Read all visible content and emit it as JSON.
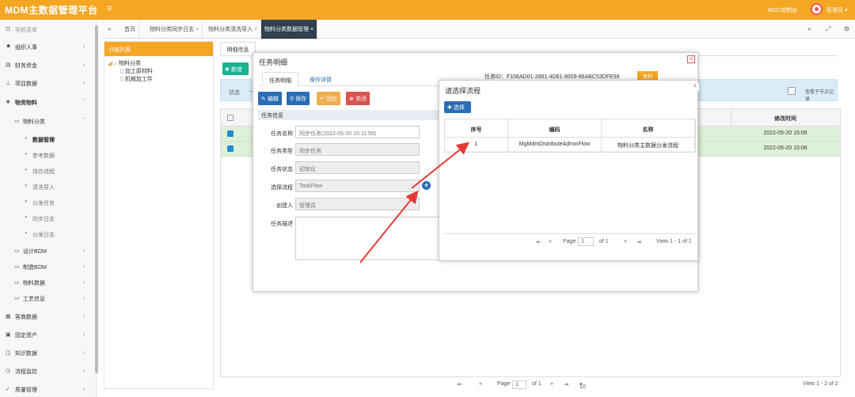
{
  "app": {
    "title": "MDM主数据管理平台",
    "menu_icon": "≡",
    "top_link": "MDC控制台",
    "username": "管理员"
  },
  "sidebar": {
    "header": "导航菜单",
    "items": [
      {
        "label": "组织人事",
        "icon": "people-icon"
      },
      {
        "label": "财务资金",
        "icon": "wallet-icon"
      },
      {
        "label": "项目数据",
        "icon": "sitemap-icon"
      },
      {
        "label": "物资物料",
        "icon": "cubes-icon"
      },
      {
        "label": "物料分类",
        "icon": "folder-icon"
      },
      {
        "label": "数据管理",
        "icon": "dot-icon"
      },
      {
        "label": "参考数据",
        "icon": "dot-icon"
      },
      {
        "label": "待办流程",
        "icon": "dot-icon"
      },
      {
        "label": "清洗导入",
        "icon": "dot-icon"
      },
      {
        "label": "分发任务",
        "icon": "dot-icon"
      },
      {
        "label": "同步日志",
        "icon": "dot-icon"
      },
      {
        "label": "分发日志",
        "icon": "dot-icon"
      },
      {
        "label": "设计BOM",
        "icon": "folder-icon"
      },
      {
        "label": "制造BOM",
        "icon": "folder-icon"
      },
      {
        "label": "物料数据",
        "icon": "folder-icon"
      },
      {
        "label": "工艺信息",
        "icon": "folder-icon"
      },
      {
        "label": "客商数据",
        "icon": "store-icon"
      },
      {
        "label": "固定资产",
        "icon": "building-icon"
      },
      {
        "label": "知识数据",
        "icon": "book-icon"
      },
      {
        "label": "流程监控",
        "icon": "clock-icon"
      },
      {
        "label": "质量管理",
        "icon": "check-icon"
      }
    ]
  },
  "tabs": [
    {
      "label": "首页"
    },
    {
      "label": "物料分类同步日志"
    },
    {
      "label": "物料分类清洗导入"
    },
    {
      "label": "物料分类数据管理"
    }
  ],
  "tree": {
    "header": "分组列表",
    "root": "物料分类",
    "children": [
      "加工原材料",
      "机械加工件"
    ]
  },
  "main": {
    "subtab": "明细信息",
    "add_button": "新增",
    "filter_label": "状态",
    "filter_placeholder": "—",
    "include_children": "查看子节点记录",
    "col_modified": "修改时间",
    "rows": [
      {
        "modified": "2022-05-20 15:06"
      },
      {
        "modified": "2022-05-20 15:06"
      }
    ],
    "pager": {
      "page_label": "Page",
      "page_value": "1",
      "of": "of 1",
      "page_size": "10",
      "summary": "View 1 - 2 of 2"
    }
  },
  "task_modal": {
    "title": "任务明细",
    "tabs": [
      "任务明细",
      "操作详情"
    ],
    "task_id": "任务ID：F106AD01-2861-4D61-9009-86ABC53DFE59",
    "copy_button": "复制",
    "buttons": {
      "edit": "编辑",
      "save": "保存",
      "rollback": "回应",
      "close": "关闭"
    },
    "section": "任务信息",
    "fields": {
      "name_label": "任务名称",
      "name_value": "同步任务(2022-05-20 15:11:56)",
      "type_label": "任务类型",
      "type_value": "同步任务",
      "status_label": "任务状态",
      "status_value": "初始化",
      "flow_label": "选择流程",
      "flow_value": "TaskFlow",
      "creator_label": "创建人",
      "creator_value": "管理员",
      "desc_label": "任务描述"
    }
  },
  "flow_modal": {
    "title": "请选择流程",
    "select_button": "选择",
    "columns": [
      "序号",
      "编码",
      "名称"
    ],
    "rows": [
      {
        "no": "1",
        "code": "MgMdmDistributeAdminFlow",
        "name": "物料分类主数据分发流程"
      }
    ],
    "pager": {
      "page_label": "Page",
      "page_value": "1",
      "of": "of 1",
      "summary": "View 1 - 1 of 1"
    }
  },
  "colors": {
    "brand": "#f5a623",
    "primary": "#2a6db5",
    "success": "#1ab394",
    "danger": "#d9534f",
    "arrow": "#e53935",
    "dark_tab": "#2f4050"
  }
}
